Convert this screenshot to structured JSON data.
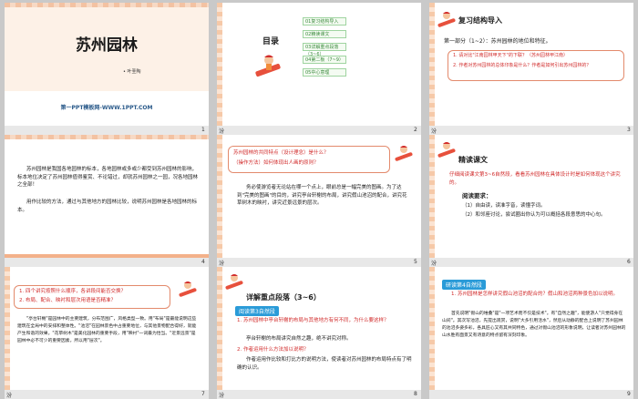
{
  "slides": [
    {
      "number": "1",
      "note": "",
      "title": "苏州园林",
      "author": "• 叶圣陶",
      "footer": "第一PPT模板网-WWW.1PPT.COM"
    },
    {
      "number": "2",
      "note": "汾",
      "title": "目录",
      "toc": [
        "01复习结构导入",
        "02精读课文",
        "03详解重点段落（3~6）",
        "04第二板（7~9）",
        "05中心意理"
      ]
    },
    {
      "number": "3",
      "note": "汾",
      "heading": "复习结构导入",
      "line1": "第一部分（1~2）：苏州园林的地位和特征。",
      "q1": "1. 请对比\"江南园林甲天下\"的下联？（苏州园林甲江南）",
      "q2": "2. 作者对苏州园林的总体印象是什么？作者是如何引出苏州园林的？"
    },
    {
      "number": "4",
      "note": "",
      "p1": "苏州园林是我国各地园林的标本，各地园林或多或少都受到苏州园林的影响，标本地位决定了苏州园林值得鉴赏、不论错过，却就苏州园林之一园，况各地园林之全部！",
      "p2": "用作比较的方法，通过与其他地方的园林比较，说明苏州园林是各地园林的标本。"
    },
    {
      "number": "5",
      "note": "汾",
      "q1": "苏州园林的共同特点（设计理念）是什么？",
      "q2": "（操作方法）如何体现出人画的原则？",
      "body": "务必使游览者无论站在哪一个点上，眼前总是一幅完美的图画。为了达到\"完美的图画\"的目的，讲究亭台轩榭的布局，讲究假山池沼的配合，讲究花草树木的映衬，讲究近景远景的层次。"
    },
    {
      "number": "6",
      "note": "汾",
      "heading": "精读课文",
      "intro": "仔细阅读课文第3~6自然段，看看苏州园林在具体设计时是如何体现这个讲究的。",
      "req_title": "阅读要求：",
      "req1": "（1）自由读，读准字音，读懂字词。",
      "req2": "（2）和邻座讨论，尝试圈出你认为可以概括各段意思的中心句。"
    },
    {
      "number": "7",
      "note": "汾",
      "q1": "1. 四个讲究按照什么顺序，各讲段间能否交换？",
      "q2": "2. 布局、配合、映衬和层次用语是否精准？",
      "body": "\"亭台轩榭\"是园林中的主要建筑，分布范围广，风格类型一致。用\"布局\"是最能说明这些建筑在全局中的安排和整体性。\"池沼\"在园林景色中占重要地位，与其他景物配合得好，就能产生和谐的效果。\"花草树木\"是美化园林的重要手段，用\"映衬\"一词最为恰当。\"近景远景\"是园林中必不可少的重要因素，所以用\"层次\"。"
    },
    {
      "number": "8",
      "note": "汾",
      "heading": "详解重点段落（3~6）",
      "pill": "阅读第3自然段",
      "q1": "1. 苏州园林中亭台轩榭的布局与其他地方有何不同，为什么要这样？",
      "a1": "亭台轩榭的布局讲究自然之趣，绝不讲究对称。",
      "q2": "2. 作者运用什么方法加以说明？",
      "a2": "作者运用作比较和打比方的说明方法，使读者对苏州园林的布局特点有了明确的认识。"
    },
    {
      "number": "9",
      "note": "",
      "pill": "研读第4自然段",
      "q1": "1. 苏州园林是怎样讲究假山池沼的配合的？假山和池沼两种景色加以说明。",
      "body": "首先说明\"假山的堆叠\"是\"一项艺术而不仅是技术\"。有\"自然之趣\"，能使游人\"只觉得身在山间\"。其次写池沼，先提出观赏，说明\"大多引用活水\"，然后从动静的配合上说明了苏州园林的池沼多姿多彩，各具匠心又有其共同特色，通过对假山池沼的形象说明，让读者对苏州园林的山水胜有面景又有诗意的特点留有深刻印象。"
    }
  ]
}
